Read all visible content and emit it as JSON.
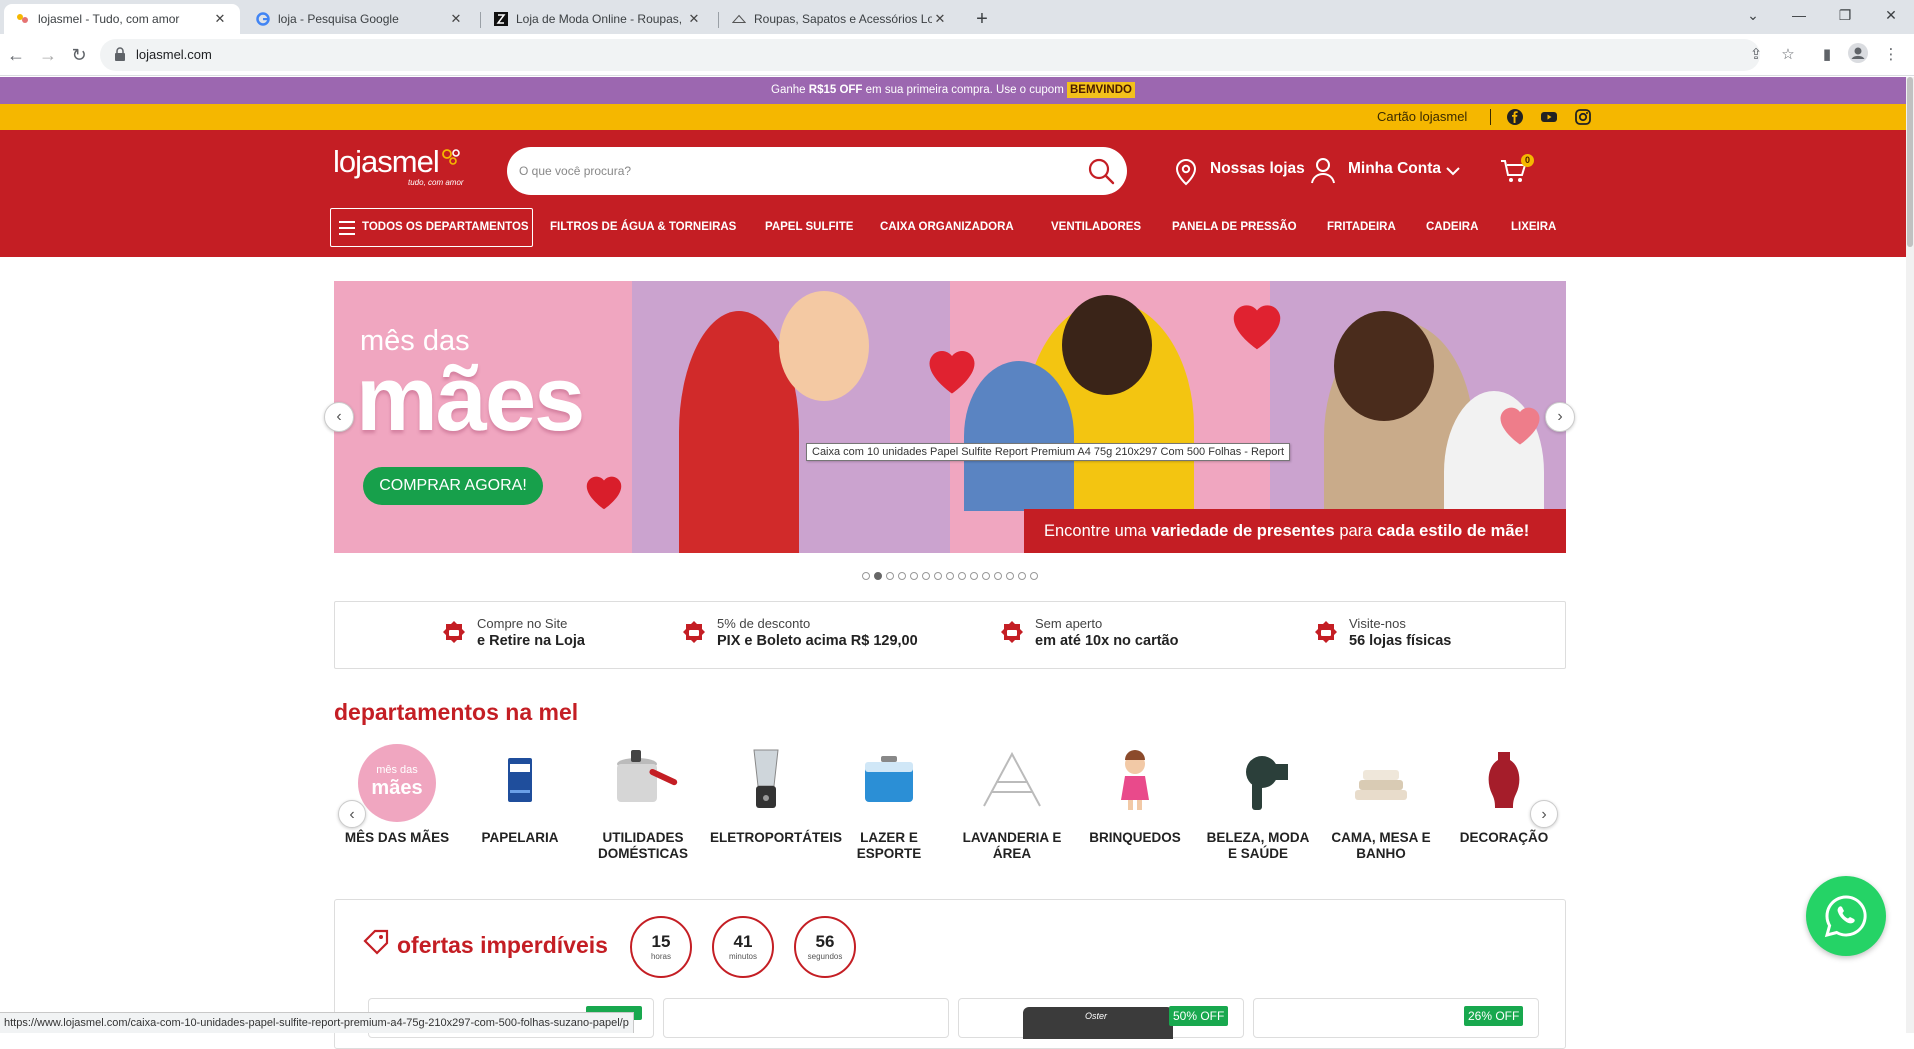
{
  "browser": {
    "tabs": [
      {
        "title": "lojasmel - Tudo, com amor",
        "active": true
      },
      {
        "title": "loja - Pesquisa Google"
      },
      {
        "title": "Loja de Moda Online - Roupas, C"
      },
      {
        "title": "Roupas, Sapatos e Acessórios Lo"
      }
    ],
    "new_tab": "+",
    "url": "lojasmel.com"
  },
  "promo": {
    "text_before": "Ganhe ",
    "amount": "R$15 OFF",
    "text_after": " em sua primeira compra. Use o cupom ",
    "coupon": "BEMVINDO"
  },
  "topbar": {
    "card_link": "Cartão lojasmel"
  },
  "header": {
    "brand": "lojasmel",
    "tagline": "tudo, com amor",
    "search_placeholder": "O que você procura?",
    "stores": "Nossas lojas",
    "account": "Minha Conta",
    "cart_count": "0"
  },
  "menu": {
    "all_departments": "TODOS OS DEPARTAMENTOS",
    "items": [
      "FILTROS DE ÁGUA & TORNEIRAS",
      "PAPEL SULFITE",
      "CAIXA ORGANIZADORA",
      "VENTILADORES",
      "PANELA DE PRESSÃO",
      "FRITADEIRA",
      "CADEIRA",
      "LIXEIRA"
    ]
  },
  "banner": {
    "small_title": "mês das",
    "big_title": "mães",
    "cta": "COMPRAR AGORA!",
    "strip_1": "Encontre uma ",
    "strip_2": "variedade de presentes",
    "strip_3": " para ",
    "strip_4": "cada estilo de mãe!",
    "slide_count": 15,
    "active_slide": 2
  },
  "tooltip": "Caixa com 10 unidades Papel Sulfite Report Premium A4 75g 210x297 Com 500 Folhas - Report",
  "benefits": [
    {
      "line1": "Compre no Site",
      "line2": "e Retire na Loja"
    },
    {
      "line1": "5% de desconto",
      "line2": "PIX e Boleto acima R$ 129,00"
    },
    {
      "line1": "Sem aperto",
      "line2": "em até 10x no cartão"
    },
    {
      "line1": "Visite-nos",
      "line2": "56 lojas físicas"
    }
  ],
  "departments_title": "departamentos na mel",
  "departments": [
    {
      "label": "MÊS DAS MÃES",
      "badge_small": "mês das",
      "badge_big": "mães"
    },
    {
      "label": "PAPELARIA"
    },
    {
      "label": "UTILIDADES DOMÉSTICAS"
    },
    {
      "label": "ELETROPORTÁTEIS"
    },
    {
      "label": "LAZER E ESPORTE"
    },
    {
      "label": "LAVANDERIA E ÁREA"
    },
    {
      "label": "BRINQUEDOS"
    },
    {
      "label": "BELEZA, MODA E SAÚDE"
    },
    {
      "label": "CAMA, MESA E BANHO"
    },
    {
      "label": "DECORAÇÃO"
    }
  ],
  "offers": {
    "title": "ofertas imperdíveis",
    "timer": [
      {
        "value": "15",
        "unit": "horas"
      },
      {
        "value": "41",
        "unit": "minutos"
      },
      {
        "value": "56",
        "unit": "segundos"
      }
    ],
    "badges": [
      "50% OFF",
      "26% OFF"
    ],
    "product_brand": "Oster"
  },
  "status_url": "https://www.lojasmel.com/caixa-com-10-unidades-papel-sulfite-report-premium-a4-75g-210x297-com-500-folhas-suzano-papel/p",
  "colors": {
    "brand_red": "#c41e24",
    "promo_purple": "#9c67b0",
    "yellow": "#f5b700",
    "green": "#17a04b",
    "whatsapp": "#25d366"
  }
}
